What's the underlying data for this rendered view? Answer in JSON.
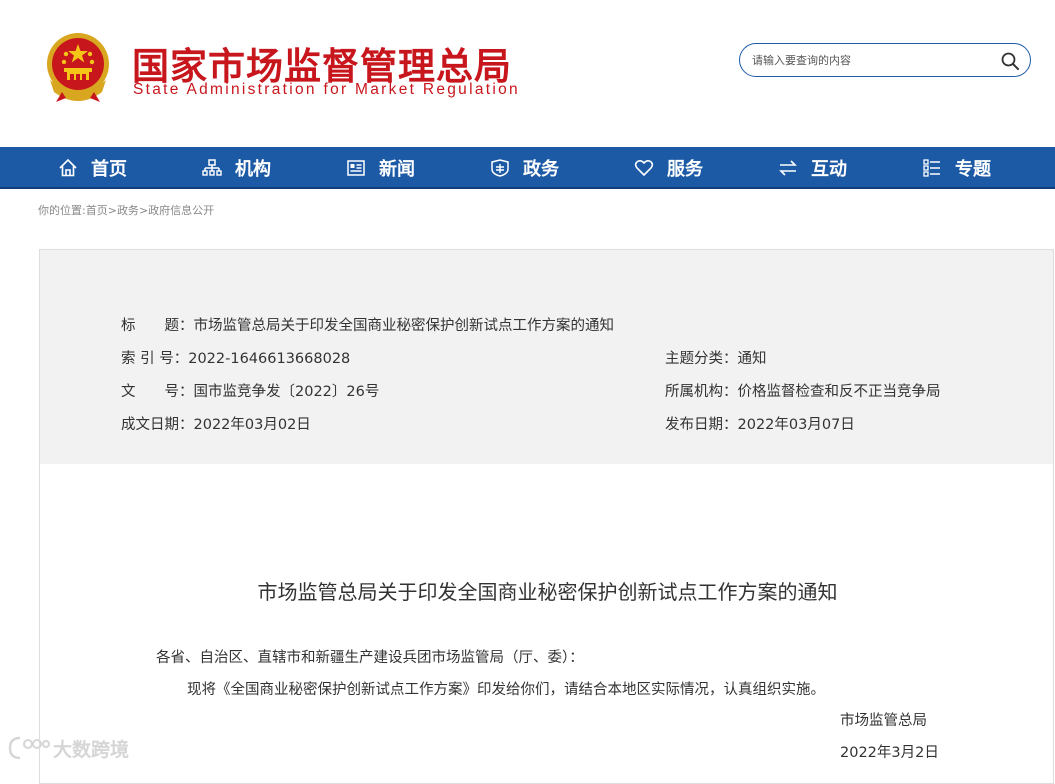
{
  "header": {
    "logo_cn": "国家市场监督管理总局",
    "logo_en": "State Administration for Market Regulation",
    "search_placeholder": "请输入要查询的内容"
  },
  "nav": [
    {
      "label": "首页",
      "icon": "home-icon"
    },
    {
      "label": "机构",
      "icon": "org-icon"
    },
    {
      "label": "新闻",
      "icon": "news-icon"
    },
    {
      "label": "政务",
      "icon": "affairs-icon"
    },
    {
      "label": "服务",
      "icon": "heart-icon"
    },
    {
      "label": "互动",
      "icon": "exchange-icon"
    },
    {
      "label": "专题",
      "icon": "topic-icon"
    }
  ],
  "breadcrumb": {
    "prefix": "你的位置:",
    "items": [
      "首页",
      "政务",
      "政府信息公开"
    ],
    "sep": ">"
  },
  "info": {
    "title_key": "标　　题：",
    "title_val": "市场监管总局关于印发全国商业秘密保护创新试点工作方案的通知",
    "index_key": "索 引 号：",
    "index_val": "2022-1646613668028",
    "topic_key": "主题分类：",
    "topic_val": "通知",
    "doc_key": "文　　号：",
    "doc_val": "国市监竞争发〔2022〕26号",
    "org_key": "所属机构：",
    "org_val": "价格监督检查和反不正当竞争局",
    "date_key": "成文日期：",
    "date_val": "2022年03月02日",
    "pub_key": "发布日期：",
    "pub_val": "2022年03月07日"
  },
  "document": {
    "title": "市场监管总局关于印发全国商业秘密保护创新试点工作方案的通知",
    "salutation": "各省、自治区、直辖市和新疆生产建设兵团市场监管局（厅、委）：",
    "body": "现将《全国商业秘密保护创新试点工作方案》印发给你们，请结合本地区实际情况，认真组织实施。",
    "signer": "市场监管总局",
    "date": "2022年3月2日"
  },
  "watermark": "大数跨境",
  "colors": {
    "brand_red": "#c8161d",
    "nav_blue": "#1d5aa5"
  }
}
